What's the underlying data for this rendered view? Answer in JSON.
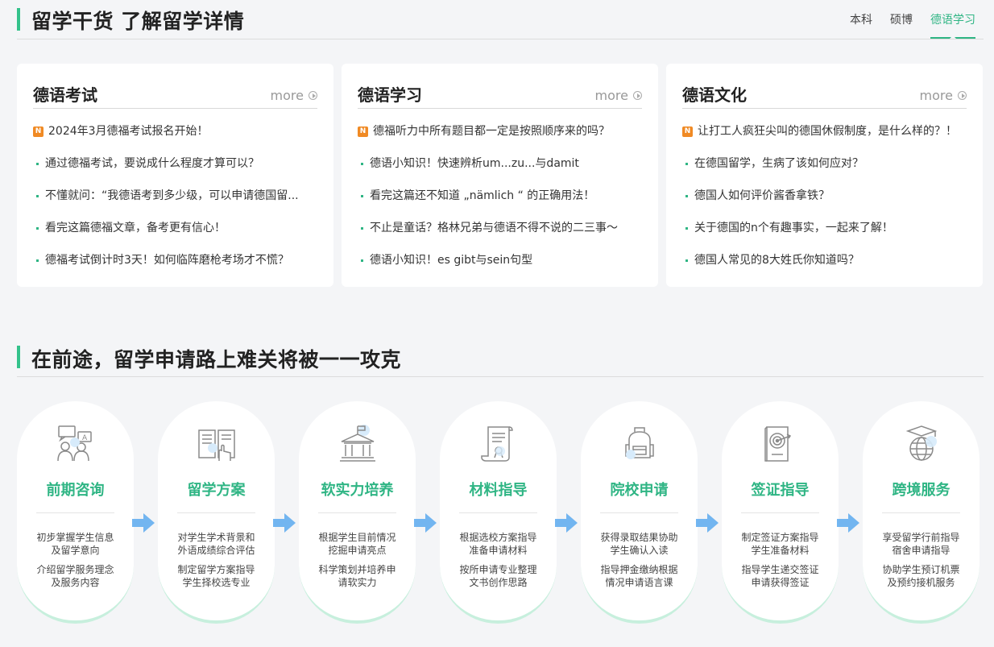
{
  "section1": {
    "title": "留学干货 了解留学详情",
    "tabs": [
      {
        "label": "本科",
        "active": false
      },
      {
        "label": "硕博",
        "active": false
      },
      {
        "label": "德语学习",
        "active": true
      }
    ]
  },
  "cards": [
    {
      "title": "德语考试",
      "more": "more",
      "items": [
        {
          "text": "2024年3月德福考试报名开始！",
          "badge": "N"
        },
        {
          "text": "通过德福考试，要说成什么程度才算可以？"
        },
        {
          "text": "不懂就问：“我德语考到多少级，可以申请德国留..."
        },
        {
          "text": "看完这篇德福文章，备考更有信心！"
        },
        {
          "text": "德福考试倒计时3天！如何临阵磨枪考场才不慌？"
        }
      ]
    },
    {
      "title": "德语学习",
      "more": "more",
      "items": [
        {
          "text": "德福听力中所有题目都一定是按照顺序来的吗？",
          "badge": "N"
        },
        {
          "text": "德语小知识！快速辨析um...zu...与damit"
        },
        {
          "text": "看完这篇还不知道 „nämlich “ 的正确用法！"
        },
        {
          "text": "不止是童话？格林兄弟与德语不得不说的二三事～"
        },
        {
          "text": "德语小知识！es gibt与sein句型"
        }
      ]
    },
    {
      "title": "德语文化",
      "more": "more",
      "items": [
        {
          "text": "让打工人疯狂尖叫的德国休假制度，是什么样的？！",
          "badge": "N"
        },
        {
          "text": "在德国留学，生病了该如何应对？"
        },
        {
          "text": "德国人如何评价酱香拿铁？"
        },
        {
          "text": "关于德国的n个有趣事实，一起来了解！"
        },
        {
          "text": "德国人常见的8大姓氏你知道吗？"
        }
      ]
    }
  ],
  "section2": {
    "title": "在前途，留学申请路上难关将被一一攻克"
  },
  "services": [
    {
      "title": "前期咨询",
      "icon": "consult-icon",
      "desc1": [
        "初步掌握学生信息",
        "及留学意向"
      ],
      "desc2": [
        "介绍留学服务理念",
        "及服务内容"
      ]
    },
    {
      "title": "留学方案",
      "icon": "plan-book-icon",
      "desc1": [
        "对学生学术背景和",
        "外语成绩综合评估"
      ],
      "desc2": [
        "制定留学方案指导",
        "学生择校选专业"
      ]
    },
    {
      "title": "软实力培养",
      "icon": "institution-icon",
      "desc1": [
        "根据学生目前情况",
        "挖掘申请亮点"
      ],
      "desc2": [
        "科学策划并培养申",
        "请软实力"
      ]
    },
    {
      "title": "材料指导",
      "icon": "document-scroll-icon",
      "desc1": [
        "根据选校方案指导",
        "准备申请材料"
      ],
      "desc2": [
        "按所申请专业整理",
        "文书创作思路"
      ]
    },
    {
      "title": "院校申请",
      "icon": "backpack-icon",
      "desc1": [
        "获得录取结果协助",
        "学生确认入读"
      ],
      "desc2": [
        "指导押金缴纳根据",
        "情况申请语言课"
      ]
    },
    {
      "title": "签证指导",
      "icon": "visa-target-icon",
      "desc1": [
        "制定签证方案指导",
        "学生准备材料"
      ],
      "desc2": [
        "指导学生递交签证",
        "申请获得签证"
      ]
    },
    {
      "title": "跨境服务",
      "icon": "globe-graduation-icon",
      "desc1": [
        "享受留学行前指导",
        "宿舍申请指导"
      ],
      "desc2": [
        "协助学生预订机票",
        "及预约接机服务"
      ]
    }
  ],
  "colors": {
    "accent": "#2fb584",
    "arrow": "#5aa9ee",
    "badge": "#f08a24"
  }
}
